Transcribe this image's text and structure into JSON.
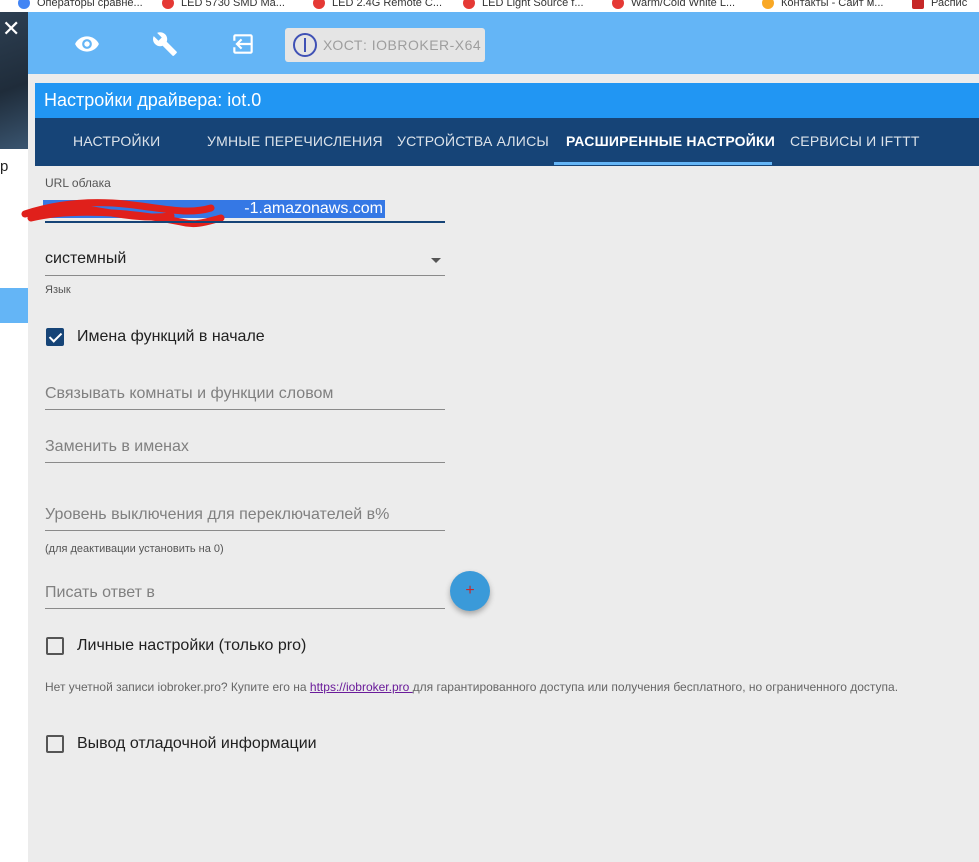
{
  "bookmarks": [
    {
      "label": "Операторы сравне...",
      "color": "#4285f4"
    },
    {
      "label": "LED 5730 SMD Ma...",
      "color": "#e53935"
    },
    {
      "label": "LED 2.4G Remote C...",
      "color": "#e53935"
    },
    {
      "label": "LED Light Source f...",
      "color": "#e53935"
    },
    {
      "label": "Warm/Cold White L...",
      "color": "#e53935"
    },
    {
      "label": "Контакты - Сайт м...",
      "color": "#f9a825"
    },
    {
      "label": "Распис",
      "color": "#c62828"
    }
  ],
  "sidebar": {
    "close_glyph": "✕",
    "partial_label": "р"
  },
  "toolbar": {
    "host_label": "ХОСТ: IOBROKER-X64"
  },
  "title": "Настройки драйвера: iot.0",
  "tabs": [
    {
      "label": "НАСТРОЙКИ",
      "active": false
    },
    {
      "label": "УМНЫЕ ПЕРЕЧИСЛЕНИЯ",
      "active": false
    },
    {
      "label": "УСТРОЙСТВА АЛИСЫ",
      "active": false
    },
    {
      "label": "РАСШИРЕННЫЕ НАСТРОЙКИ",
      "active": true
    },
    {
      "label": "СЕРВИСЫ И IFTTT",
      "active": false
    }
  ],
  "form": {
    "cloud_url": {
      "label": "URL облака",
      "value": "-1.amazonaws.com"
    },
    "language": {
      "value": "системный",
      "helper": "Язык"
    },
    "functions_first": {
      "label": "Имена функций в начале",
      "checked": true
    },
    "concat_word": {
      "placeholder": "Связывать комнаты и функции словом"
    },
    "replace_names": {
      "placeholder": "Заменить в именах"
    },
    "off_level": {
      "placeholder": "Уровень выключения для переключателей в%",
      "helper": "(для деактивации установить на 0)"
    },
    "response_to": {
      "placeholder": "Писать ответ в",
      "add_glyph": "+"
    },
    "pro_settings": {
      "label": "Личные настройки (только pro)",
      "checked": false
    },
    "pro_info": {
      "before": "Нет учетной записи iobroker.pro? Купите его на ",
      "link": "https://iobroker.pro ",
      "after": "для гарантированного доступа или получения бесплатного, но ограниченного доступа."
    },
    "debug": {
      "label": "Вывод отладочной информации",
      "checked": false
    }
  },
  "colors": {
    "toolbar": "#64b5f6",
    "title_bar": "#2196f3",
    "tabs_bg": "#164477",
    "tab_indicator": "#64b5f6",
    "checkbox_checked": "#164477",
    "fab": "#3a9ad9"
  }
}
